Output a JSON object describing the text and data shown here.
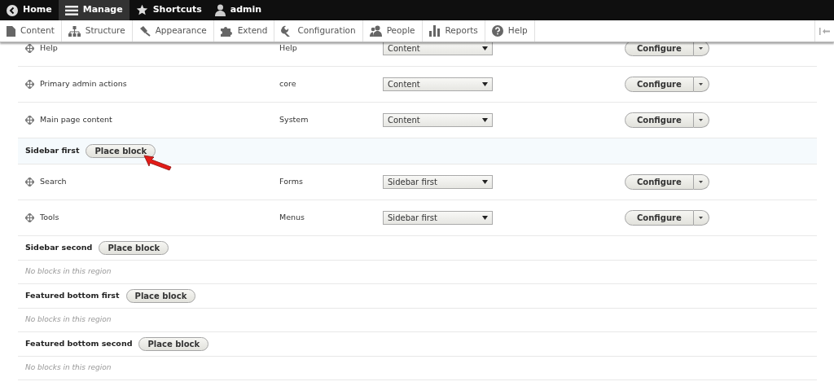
{
  "toolbar": [
    {
      "label": "Home",
      "selected": false
    },
    {
      "label": "Manage",
      "selected": true
    },
    {
      "label": "Shortcuts",
      "selected": false
    },
    {
      "label": "admin",
      "selected": false
    }
  ],
  "tray": [
    {
      "label": "Content"
    },
    {
      "label": "Structure"
    },
    {
      "label": "Appearance"
    },
    {
      "label": "Extend"
    },
    {
      "label": "Configuration"
    },
    {
      "label": "People"
    },
    {
      "label": "Reports"
    },
    {
      "label": "Help"
    }
  ],
  "rows": [
    {
      "kind": "block",
      "name": "Help",
      "category": "Help",
      "region": "Content",
      "action": "Configure"
    },
    {
      "kind": "block",
      "name": "Primary admin actions",
      "category": "core",
      "region": "Content",
      "action": "Configure"
    },
    {
      "kind": "block",
      "name": "Main page content",
      "category": "System",
      "region": "Content",
      "action": "Configure"
    },
    {
      "kind": "region",
      "name": "Sidebar first",
      "button": "Place block",
      "highlighted": true,
      "arrow": true
    },
    {
      "kind": "block",
      "name": "Search",
      "category": "Forms",
      "region": "Sidebar first",
      "action": "Configure"
    },
    {
      "kind": "block",
      "name": "Tools",
      "category": "Menus",
      "region": "Sidebar first",
      "action": "Configure"
    },
    {
      "kind": "region",
      "name": "Sidebar second",
      "button": "Place block",
      "highlighted": false,
      "arrow": false
    },
    {
      "kind": "empty",
      "text": "No blocks in this region"
    },
    {
      "kind": "region",
      "name": "Featured bottom first",
      "button": "Place block",
      "highlighted": false,
      "arrow": false
    },
    {
      "kind": "empty",
      "text": "No blocks in this region"
    },
    {
      "kind": "region",
      "name": "Featured bottom second",
      "button": "Place block",
      "highlighted": false,
      "arrow": false
    },
    {
      "kind": "empty",
      "text": "No blocks in this region"
    }
  ]
}
